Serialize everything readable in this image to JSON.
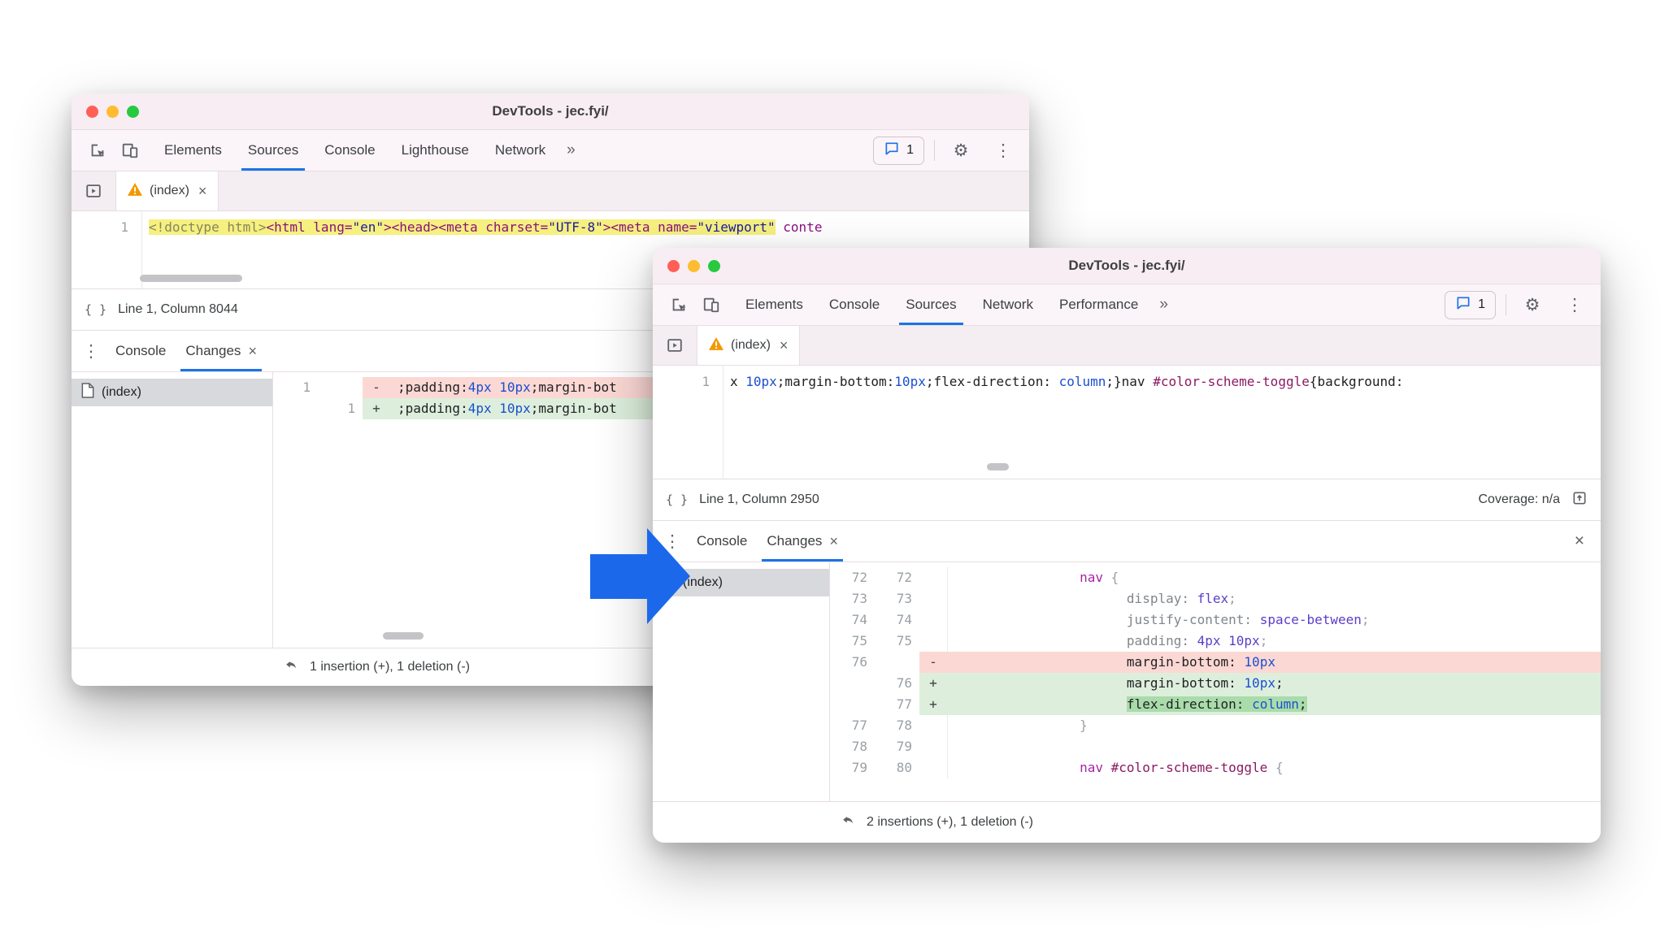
{
  "icons": {
    "close": "×",
    "kebab": "⋮",
    "overflow": "»",
    "gear": "⚙",
    "braces": "{ }"
  },
  "arrow": {
    "color": "#1b69ea"
  },
  "win_back": {
    "title": "DevTools - jec.fyi/",
    "toolbar": {
      "tabs": [
        "Elements",
        "Sources",
        "Console",
        "Lighthouse",
        "Network"
      ],
      "issues_count": "1"
    },
    "file_tab": {
      "label": "(index)"
    },
    "editor": {
      "line_number": "1",
      "segments": [
        {
          "t": "<!doctype html>",
          "c": "doc",
          "hl": true
        },
        {
          "t": "<html lang=",
          "c": "tag",
          "hl": true
        },
        {
          "t": "\"en\"",
          "c": "str",
          "hl": true
        },
        {
          "t": "><head><meta charset=",
          "c": "tag",
          "hl": true
        },
        {
          "t": "\"UTF-8\"",
          "c": "str",
          "hl": true
        },
        {
          "t": "><meta name=",
          "c": "tag",
          "hl": true
        },
        {
          "t": "\"viewport\"",
          "c": "str",
          "hl": true
        },
        {
          "t": " conte",
          "c": "tag"
        }
      ]
    },
    "status": "Line 1, Column 8044",
    "drawer": {
      "tabs": [
        "Console",
        "Changes"
      ],
      "file": "(index)",
      "rows": [
        {
          "old": "1",
          "new": "",
          "sign": "-",
          "kind": "del",
          "indent": 0,
          "segments": [
            {
              "t": ";padding:",
              "c": "plain"
            },
            {
              "t": "4px",
              "c": "num"
            },
            {
              "t": " ",
              "c": "plain"
            },
            {
              "t": "10px",
              "c": "num"
            },
            {
              "t": ";margin-bot",
              "c": "plain"
            }
          ]
        },
        {
          "old": "",
          "new": "1",
          "sign": "+",
          "kind": "add",
          "indent": 0,
          "segments": [
            {
              "t": ";padding:",
              "c": "plain"
            },
            {
              "t": "4px",
              "c": "num"
            },
            {
              "t": " ",
              "c": "plain"
            },
            {
              "t": "10px",
              "c": "num"
            },
            {
              "t": ";margin-bot",
              "c": "plain"
            }
          ]
        }
      ],
      "summary": "1 insertion (+), 1 deletion (-)"
    }
  },
  "win_front": {
    "title": "DevTools - jec.fyi/",
    "toolbar": {
      "tabs": [
        "Elements",
        "Console",
        "Sources",
        "Network",
        "Performance"
      ],
      "issues_count": "1"
    },
    "file_tab": {
      "label": "(index)"
    },
    "editor": {
      "line_number": "1",
      "segments": [
        {
          "t": "x ",
          "c": "plain"
        },
        {
          "t": "10px",
          "c": "num"
        },
        {
          "t": ";margin-bottom:",
          "c": "plain"
        },
        {
          "t": "10px",
          "c": "num"
        },
        {
          "t": ";flex-direction: ",
          "c": "plain"
        },
        {
          "t": "column",
          "c": "num"
        },
        {
          "t": ";}nav ",
          "c": "plain"
        },
        {
          "t": "#color-scheme-toggle",
          "c": "id"
        },
        {
          "t": "{background:",
          "c": "plain"
        }
      ]
    },
    "status": "Line 1, Column 2950",
    "coverage": "Coverage: n/a",
    "drawer": {
      "tabs": [
        "Console",
        "Changes"
      ],
      "file": "(index)",
      "rows": [
        {
          "old": "72",
          "new": "72",
          "sign": "",
          "kind": "ctx",
          "indent": 16,
          "segments": [
            {
              "t": "nav ",
              "c": "sel"
            },
            {
              "t": "{",
              "c": "punc"
            }
          ]
        },
        {
          "old": "73",
          "new": "73",
          "sign": "",
          "kind": "ctx",
          "indent": 22,
          "segments": [
            {
              "t": "display:",
              "c": "prop"
            },
            {
              "t": " ",
              "c": "plain"
            },
            {
              "t": "flex",
              "c": "val"
            },
            {
              "t": ";",
              "c": "punc"
            }
          ]
        },
        {
          "old": "74",
          "new": "74",
          "sign": "",
          "kind": "ctx",
          "indent": 22,
          "segments": [
            {
              "t": "justify-content:",
              "c": "prop"
            },
            {
              "t": " ",
              "c": "plain"
            },
            {
              "t": "space-between",
              "c": "val"
            },
            {
              "t": ";",
              "c": "punc"
            }
          ]
        },
        {
          "old": "75",
          "new": "75",
          "sign": "",
          "kind": "ctx",
          "indent": 22,
          "segments": [
            {
              "t": "padding:",
              "c": "prop"
            },
            {
              "t": " ",
              "c": "plain"
            },
            {
              "t": "4px 10px",
              "c": "val"
            },
            {
              "t": ";",
              "c": "punc"
            }
          ]
        },
        {
          "old": "76",
          "new": "",
          "sign": "-",
          "kind": "del",
          "indent": 22,
          "segments": [
            {
              "t": "margin-bottom:",
              "c": "plain"
            },
            {
              "t": " ",
              "c": "plain"
            },
            {
              "t": "10px",
              "c": "num"
            }
          ]
        },
        {
          "old": "",
          "new": "76",
          "sign": "+",
          "kind": "add",
          "indent": 22,
          "segments": [
            {
              "t": "margin-bottom:",
              "c": "plain"
            },
            {
              "t": " ",
              "c": "plain"
            },
            {
              "t": "10px",
              "c": "num"
            },
            {
              "t": ";",
              "c": "plain"
            }
          ]
        },
        {
          "old": "",
          "new": "77",
          "sign": "+",
          "kind": "add",
          "indent": 22,
          "segments": [
            {
              "t": "flex-direction:",
              "c": "plain",
              "hl": true
            },
            {
              "t": " ",
              "c": "plain",
              "hl": true
            },
            {
              "t": "column",
              "c": "num",
              "hl": true
            },
            {
              "t": ";",
              "c": "plain",
              "hl": true
            }
          ]
        },
        {
          "old": "77",
          "new": "78",
          "sign": "",
          "kind": "ctx",
          "indent": 16,
          "segments": [
            {
              "t": "}",
              "c": "punc"
            }
          ]
        },
        {
          "old": "78",
          "new": "79",
          "sign": "",
          "kind": "ctx",
          "indent": 0,
          "segments": []
        },
        {
          "old": "79",
          "new": "80",
          "sign": "",
          "kind": "ctx",
          "indent": 16,
          "segments": [
            {
              "t": "nav ",
              "c": "sel"
            },
            {
              "t": "#color-scheme-toggle",
              "c": "id"
            },
            {
              "t": " ",
              "c": "plain"
            },
            {
              "t": "{",
              "c": "punc"
            }
          ]
        }
      ],
      "summary": "2 insertions (+), 1 deletion (-)"
    }
  }
}
